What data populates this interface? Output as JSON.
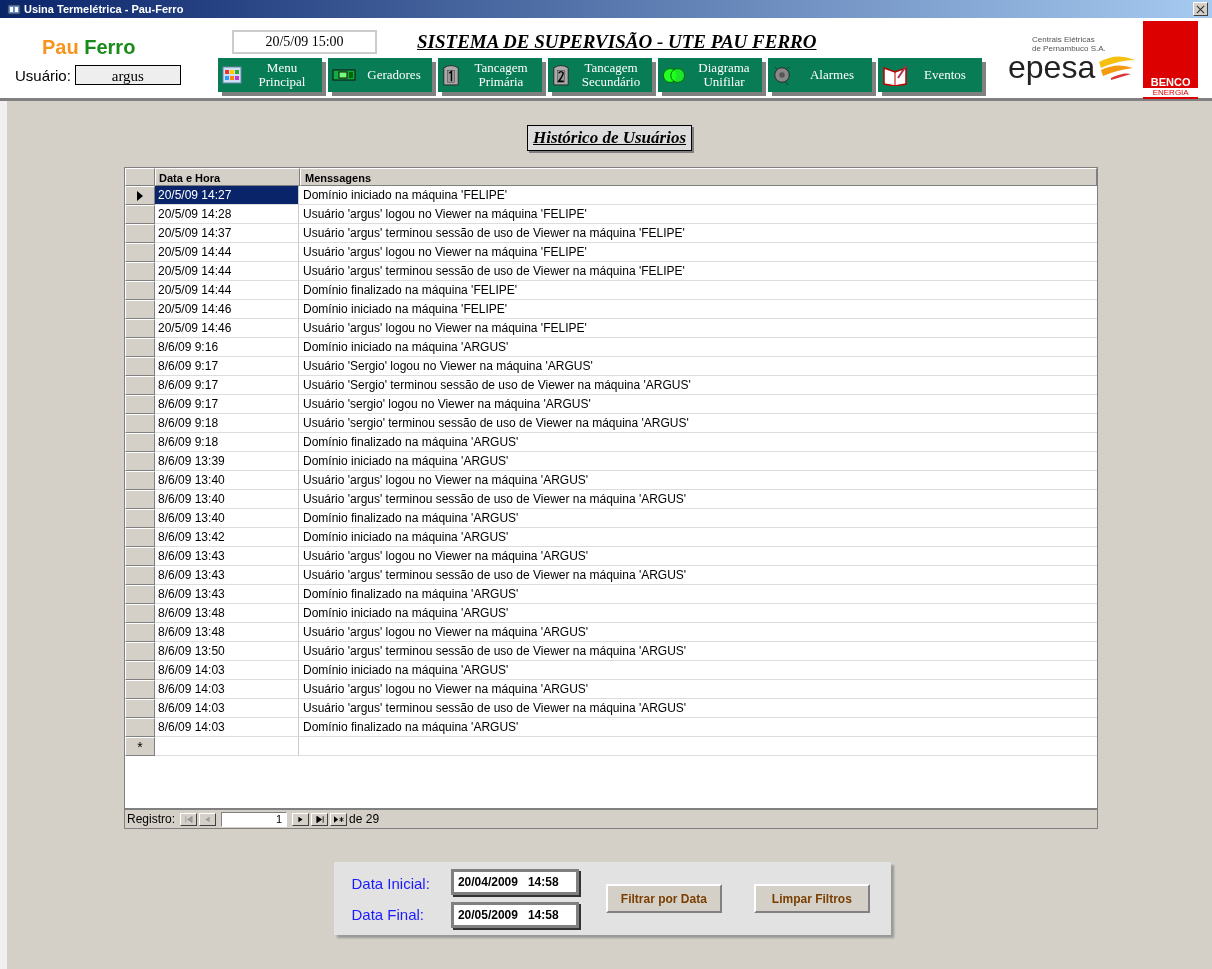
{
  "window": {
    "title": "Usina Termelétrica - Pau-Ferro"
  },
  "brand": {
    "word_1": "Pau",
    "word_2": "Ferro"
  },
  "user": {
    "label": "Usuário:",
    "value": "argus"
  },
  "clock": "20/5/09 15:00",
  "system_title": "SISTEMA DE SUPERVISÃO - UTE PAU FERRO",
  "nav_buttons": [
    {
      "kind": "grid",
      "label": "Menu Principal"
    },
    {
      "kind": "generator",
      "label": "Geradores"
    },
    {
      "kind": "tank1",
      "label": "Tancagem Primária"
    },
    {
      "kind": "tank2",
      "label": "Tancagem Secundário"
    },
    {
      "kind": "circles",
      "label": "Diagrama Unifilar"
    },
    {
      "kind": "bell",
      "label": "Alarmes"
    },
    {
      "kind": "book",
      "label": "Eventos"
    }
  ],
  "logos": {
    "epesa_caption_1": "Centrais Elétricas",
    "epesa_caption_2": "de Pernambuco S.A.",
    "epesa": "epesa",
    "benco": "BENCO",
    "benco_sub": "ENERGIA"
  },
  "page_title": "Histórico de Usuários",
  "table": {
    "columns": [
      "Data e Hora",
      "Menssagens"
    ],
    "rows": [
      {
        "date": "20/5/09 14:27",
        "message": "Domínio iniciado na máquina 'FELIPE'",
        "selected": true
      },
      {
        "date": "20/5/09 14:28",
        "message": "Usuário 'argus' logou no Viewer na máquina 'FELIPE'",
        "selected": false
      },
      {
        "date": "20/5/09 14:37",
        "message": "Usuário 'argus' terminou sessão de uso de Viewer na máquina 'FELIPE'",
        "selected": false
      },
      {
        "date": "20/5/09 14:44",
        "message": "Usuário 'argus' logou no Viewer na máquina 'FELIPE'",
        "selected": false
      },
      {
        "date": "20/5/09 14:44",
        "message": "Usuário 'argus' terminou sessão de uso de Viewer na máquina 'FELIPE'",
        "selected": false
      },
      {
        "date": "20/5/09 14:44",
        "message": "Domínio finalizado na máquina 'FELIPE'",
        "selected": false
      },
      {
        "date": "20/5/09 14:46",
        "message": "Domínio iniciado na máquina 'FELIPE'",
        "selected": false
      },
      {
        "date": "20/5/09 14:46",
        "message": "Usuário 'argus' logou no Viewer na máquina 'FELIPE'",
        "selected": false
      },
      {
        "date": "8/6/09 9:16",
        "message": "Domínio iniciado na máquina 'ARGUS'",
        "selected": false
      },
      {
        "date": "8/6/09 9:17",
        "message": "Usuário 'Sergio' logou no Viewer na máquina 'ARGUS'",
        "selected": false
      },
      {
        "date": "8/6/09 9:17",
        "message": "Usuário 'Sergio' terminou sessão de uso de Viewer na máquina 'ARGUS'",
        "selected": false
      },
      {
        "date": "8/6/09 9:17",
        "message": "Usuário 'sergio' logou no Viewer na máquina 'ARGUS'",
        "selected": false
      },
      {
        "date": "8/6/09 9:18",
        "message": "Usuário 'sergio' terminou sessão de uso de Viewer na máquina 'ARGUS'",
        "selected": false
      },
      {
        "date": "8/6/09 9:18",
        "message": "Domínio finalizado na máquina 'ARGUS'",
        "selected": false
      },
      {
        "date": "8/6/09 13:39",
        "message": "Domínio iniciado na máquina 'ARGUS'",
        "selected": false
      },
      {
        "date": "8/6/09 13:40",
        "message": "Usuário 'argus' logou no Viewer na máquina 'ARGUS'",
        "selected": false
      },
      {
        "date": "8/6/09 13:40",
        "message": "Usuário 'argus' terminou sessão de uso de Viewer na máquina 'ARGUS'",
        "selected": false
      },
      {
        "date": "8/6/09 13:40",
        "message": "Domínio finalizado na máquina 'ARGUS'",
        "selected": false
      },
      {
        "date": "8/6/09 13:42",
        "message": "Domínio iniciado na máquina 'ARGUS'",
        "selected": false
      },
      {
        "date": "8/6/09 13:43",
        "message": "Usuário 'argus' logou no Viewer na máquina 'ARGUS'",
        "selected": false
      },
      {
        "date": "8/6/09 13:43",
        "message": "Usuário 'argus' terminou sessão de uso de Viewer na máquina 'ARGUS'",
        "selected": false
      },
      {
        "date": "8/6/09 13:43",
        "message": "Domínio finalizado na máquina 'ARGUS'",
        "selected": false
      },
      {
        "date": "8/6/09 13:48",
        "message": "Domínio iniciado na máquina 'ARGUS'",
        "selected": false
      },
      {
        "date": "8/6/09 13:48",
        "message": "Usuário 'argus' logou no Viewer na máquina 'ARGUS'",
        "selected": false
      },
      {
        "date": "8/6/09 13:50",
        "message": "Usuário 'argus' terminou sessão de uso de Viewer na máquina 'ARGUS'",
        "selected": false
      },
      {
        "date": "8/6/09 14:03",
        "message": "Domínio iniciado na máquina 'ARGUS'",
        "selected": false
      },
      {
        "date": "8/6/09 14:03",
        "message": "Usuário 'argus' logou no Viewer na máquina 'ARGUS'",
        "selected": false
      },
      {
        "date": "8/6/09 14:03",
        "message": "Usuário 'argus' terminou sessão de uso de Viewer na máquina 'ARGUS'",
        "selected": false
      },
      {
        "date": "8/6/09 14:03",
        "message": "Domínio finalizado na máquina 'ARGUS'",
        "selected": false
      }
    ],
    "new_row_marker": "*"
  },
  "navigator": {
    "label": "Registro:",
    "record": "1",
    "total": "de 29"
  },
  "filter": {
    "start_label": "Data Inicial:",
    "start_value": "20/04/2009   14:58",
    "end_label": "Data Final:",
    "end_value": "20/05/2009   14:58",
    "filter_button": "Filtrar por Data",
    "clear_button": "Limpar Filtros"
  }
}
